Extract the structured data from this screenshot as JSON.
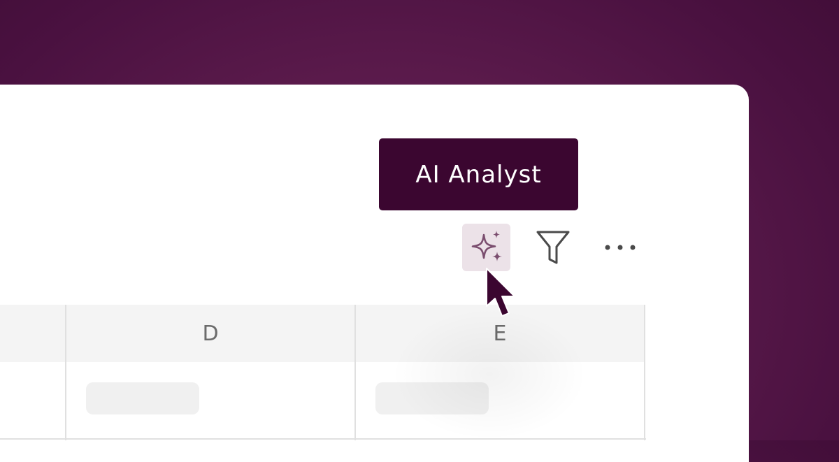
{
  "tooltip": {
    "text": "AI Analyst"
  },
  "toolbar": {
    "ai_button_icon": "sparkles-icon",
    "filter_button_icon": "filter-icon",
    "more_button_icon": "more-horizontal-icon"
  },
  "table": {
    "columns": [
      "D",
      "E"
    ]
  },
  "colors": {
    "background": "#4f1444",
    "tooltip_bg": "#3b0630",
    "accent": "#7b4e6f",
    "ai_button_bg": "#ece2e8",
    "cursor": "#3b0630"
  }
}
